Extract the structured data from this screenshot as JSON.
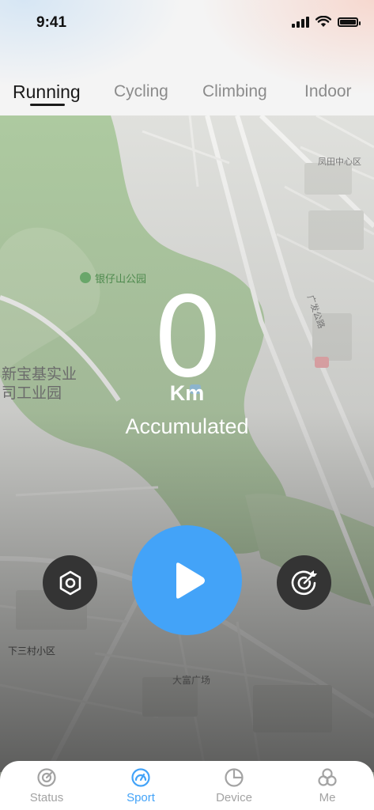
{
  "status_bar": {
    "time": "9:41"
  },
  "tabs": [
    {
      "label": "Running",
      "active": true
    },
    {
      "label": "Cycling",
      "active": false
    },
    {
      "label": "Climbing",
      "active": false
    },
    {
      "label": "Indoor",
      "active": false
    }
  ],
  "map": {
    "labels": [
      "银仔山公园",
      "新宝基实业",
      "司工业园",
      "凤田中心区",
      "广发公路",
      "大富广场",
      "下三村小区"
    ]
  },
  "distance": {
    "value": "0",
    "unit": "Km",
    "label": "Accumulated"
  },
  "controls": {
    "settings_icon": "hexagon-settings-icon",
    "start_icon": "play-icon",
    "target_icon": "target-icon"
  },
  "bottom_nav": [
    {
      "label": "Status",
      "icon": "gauge-icon",
      "active": false
    },
    {
      "label": "Sport",
      "icon": "speedometer-icon",
      "active": true
    },
    {
      "label": "Device",
      "icon": "pie-icon",
      "active": false
    },
    {
      "label": "Me",
      "icon": "circles-icon",
      "active": false
    }
  ],
  "colors": {
    "accent": "#43a3f8",
    "dark_button": "#343434",
    "inactive": "#a3a3a3"
  }
}
